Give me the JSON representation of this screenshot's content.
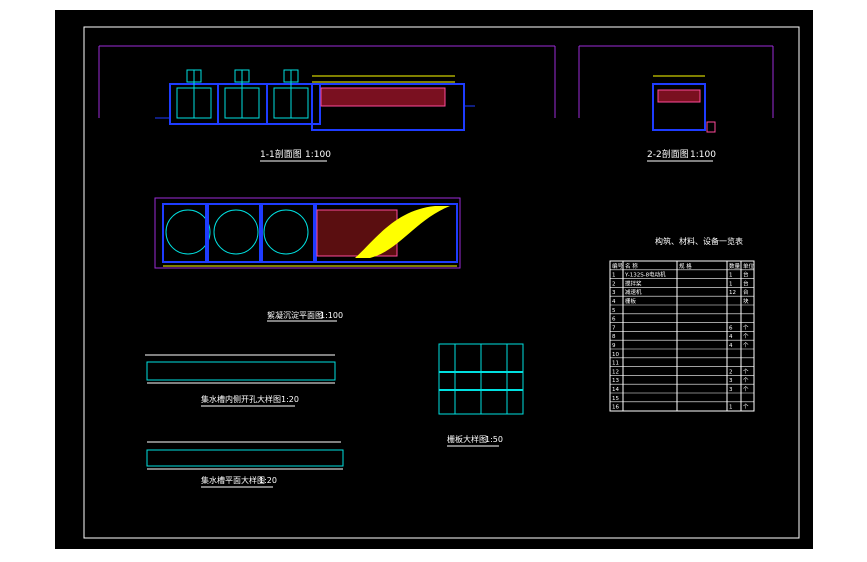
{
  "titles": {
    "section_1_1": "1-1剖面图",
    "section_1_1_scale": "1:100",
    "section_2_2": "2-2剖面图",
    "section_2_2_scale": "1:100",
    "plan": "絮凝沉淀平面图",
    "plan_scale": "1:100",
    "holes_detail": "集水槽内侧开孔大样图",
    "holes_detail_scale": "1:20",
    "trough_plan": "集水槽平面大样图",
    "trough_plan_scale": "1:20",
    "grid_detail": "栅板大样图",
    "grid_detail_scale": "1:50",
    "table": "构筑、材料、设备一览表"
  },
  "table": {
    "headers": [
      "编号",
      "名 称",
      "规 格",
      "数量",
      "单位"
    ],
    "rows": [
      [
        "1",
        "Y-132S-8电动机",
        "",
        "1",
        "台"
      ],
      [
        "2",
        "搅拌桨",
        "",
        "1",
        "台"
      ],
      [
        "3",
        "减速机",
        "",
        "12",
        "台"
      ],
      [
        "4",
        "栅板",
        "",
        "",
        "块"
      ],
      [
        "5",
        "",
        "",
        "",
        ""
      ],
      [
        "6",
        "",
        "",
        "",
        ""
      ],
      [
        "7",
        "",
        "",
        "6",
        "个"
      ],
      [
        "8",
        "",
        "",
        "4",
        "个"
      ],
      [
        "9",
        "",
        "",
        "4",
        "个"
      ],
      [
        "10",
        "",
        "",
        "",
        ""
      ],
      [
        "11",
        "",
        "",
        "",
        ""
      ],
      [
        "12",
        "",
        "",
        "2",
        "个"
      ],
      [
        "13",
        "",
        "",
        "3",
        "个"
      ],
      [
        "14",
        "",
        "",
        "3",
        "个"
      ],
      [
        "15",
        "",
        "",
        "",
        ""
      ],
      [
        "16",
        "",
        "",
        "1",
        "个"
      ]
    ]
  },
  "colors": {
    "background": "#000000",
    "frame": "#ffffff",
    "structure": "#1e3cff",
    "dimension": "#9b2cd8",
    "equipment": "#00e0e0",
    "label": "#ff4a9a",
    "fill": "#ffff00",
    "title_text": "#ffffff"
  }
}
